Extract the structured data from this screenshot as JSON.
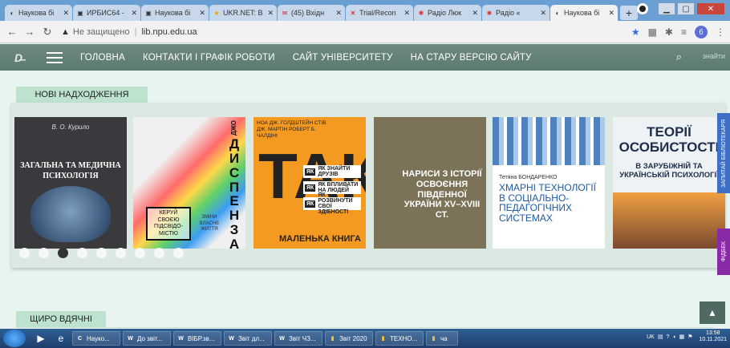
{
  "browser": {
    "tabs": [
      {
        "label": "Наукова бі",
        "icon": "ie-icon",
        "active": false
      },
      {
        "label": "ИРБИС64 -",
        "icon": "irbis-icon",
        "active": false
      },
      {
        "label": "Наукова бі",
        "icon": "irbis-icon",
        "active": false
      },
      {
        "label": "UKR.NET: В",
        "icon": "ukrnet-icon",
        "active": false
      },
      {
        "label": "(45) Вхідн",
        "icon": "mail-icon",
        "active": false
      },
      {
        "label": "Trial/Recon",
        "icon": "x-icon",
        "active": false
      },
      {
        "label": "Радіо Люк",
        "icon": "radio-icon",
        "active": false
      },
      {
        "label": "Радіо «",
        "icon": "radio-icon",
        "active": false
      },
      {
        "label": "Наукова бі",
        "icon": "ie-icon",
        "active": true
      }
    ],
    "new_tab": "+",
    "address": {
      "warning": "Не защищено",
      "url": "lib.npu.edu.ua"
    },
    "profile_letter": "б"
  },
  "site_nav": {
    "links": [
      {
        "label": "ГОЛОВНА"
      },
      {
        "label": "КОНТАКТИ І ГРАФІК РОБОТИ"
      },
      {
        "label": "САЙТ УНІВЕРСИТЕТУ"
      },
      {
        "label": "НА СТАРУ ВЕРСІЮ САЙТУ"
      }
    ],
    "find": "знайти"
  },
  "sections": {
    "new_arrivals": "НОВІ НАДХОДЖЕННЯ",
    "thanks": "ЩИРО ВДЯЧНІ"
  },
  "books": [
    {
      "author": "В. О. Курило",
      "title": "ЗАГАЛЬНА ТА МЕДИЧНА ПСИХОЛОГІЯ"
    },
    {
      "side": "ДИСПЕНЗА",
      "side_small": "ДЖО",
      "box": "КЕРУЙ СВОЄЮ ПІДСВІДО-МІСТЮ",
      "box2": "ЗМІНИ ВЛАСНЕ ЖИТТЯ"
    },
    {
      "head": "НОА ДЖ. ГОЛДШТЕЙН СТІВ ДЖ. МАРТІН РОБЕРТ Б. ЧАЛДІНІ",
      "big": "ТАК",
      "tags": [
        "ЯК ЗНАЙТИ ДРУЗІВ",
        "ЯК ВПЛИВАТИ НА ЛЮДЕЙ",
        "ЯК РОЗВИНУТИ СВОЇ ЗДІБНОСТІ"
      ],
      "foot": "МАЛЕНЬКА КНИГА"
    },
    {
      "title": "НАРИСИ З ІСТОРІЇ ОСВОЄННЯ ПІВДЕННОЇ УКРАЇНИ XV–XVIII СТ."
    },
    {
      "author": "Тетяна БОНДАРЕНКО",
      "title": "ХМАРНІ ТЕХНОЛОГІЇ В СОЦІАЛЬНО-ПЕДАГОГІЧНИХ СИСТЕМАХ"
    },
    {
      "title": "ТЕОРІЇ ОСОБИСТОСТІ",
      "subtitle": "В ЗАРУБІЖНІЙ ТА УКРАЇНСЬКІЙ ПСИХОЛОГІЇ"
    }
  ],
  "carousel": {
    "dot_count": 9,
    "active_index": 2
  },
  "side_tabs": {
    "ask": "ЗАПИТАЙ БІБЛІОТЕКАРЯ",
    "feedback": "ФІДБЕК"
  },
  "taskbar": {
    "tasks": [
      {
        "icon": "C",
        "label": "Науко..."
      },
      {
        "icon": "W",
        "label": "До звіт..."
      },
      {
        "icon": "W",
        "label": "ВІБР.зв..."
      },
      {
        "icon": "W",
        "label": "Звіт дл..."
      },
      {
        "icon": "W",
        "label": "Звіт ЧЗ..."
      },
      {
        "icon": "▮",
        "label": "Звіт 2020"
      },
      {
        "icon": "▮",
        "label": "ТЕХНО..."
      },
      {
        "icon": "▮",
        "label": "ча"
      }
    ],
    "lang": "UK",
    "time": "13:58",
    "date": "10.11.2021"
  }
}
